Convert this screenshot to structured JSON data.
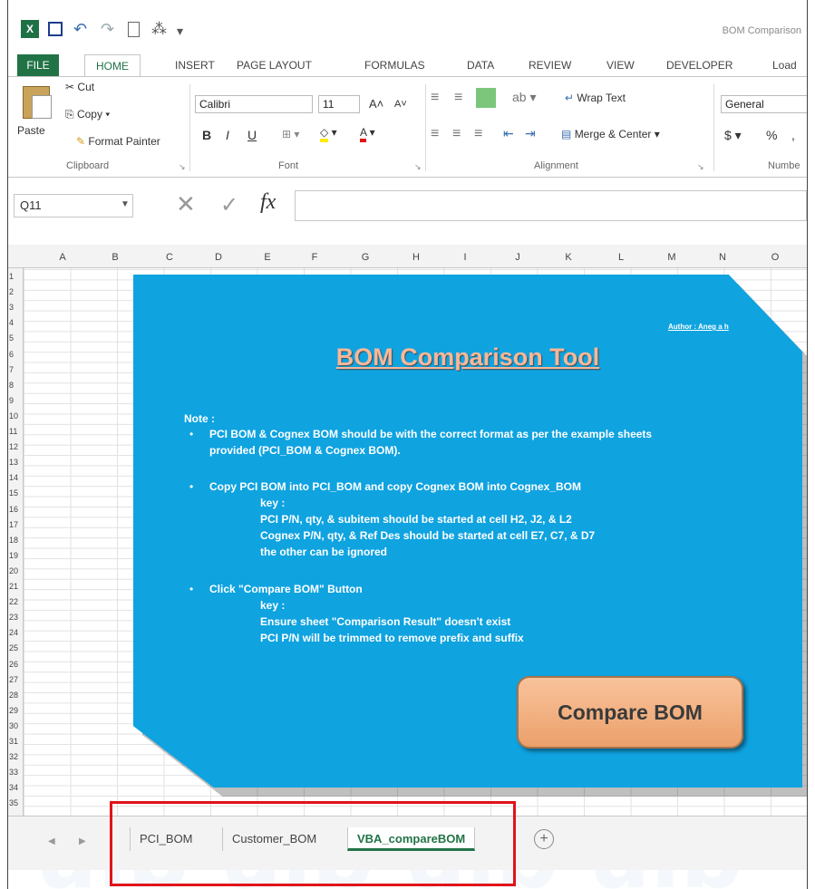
{
  "window_title": "BOM Comparison",
  "quick_access": {
    "excel_logo": "X"
  },
  "ribbon_tabs": [
    "FILE",
    "HOME",
    "INSERT",
    "PAGE LAYOUT",
    "FORMULAS",
    "DATA",
    "REVIEW",
    "VIEW",
    "DEVELOPER",
    "Load"
  ],
  "clipboard": {
    "paste": "Paste",
    "cut": "Cut",
    "copy": "Copy",
    "format_painter": "Format Painter",
    "group_label": "Clipboard"
  },
  "font": {
    "name": "Calibri",
    "size": "11",
    "bold": "B",
    "italic": "I",
    "underline": "U",
    "grow": "A˄",
    "shrink": "A˅",
    "group_label": "Font"
  },
  "alignment": {
    "wrap_text": "Wrap Text",
    "merge_center": "Merge & Center",
    "group_label": "Alignment"
  },
  "number": {
    "format": "General",
    "currency": "$",
    "percent": "%",
    "comma": ",",
    "group_label": "Numbe"
  },
  "formula_bar": {
    "name_box": "Q11",
    "fx": "fx"
  },
  "columns": [
    "A",
    "B",
    "C",
    "D",
    "E",
    "F",
    "G",
    "H",
    "I",
    "J",
    "K",
    "L",
    "M",
    "N",
    "O"
  ],
  "rows": [
    "1",
    "2",
    "3",
    "4",
    "5",
    "6",
    "7",
    "8",
    "9",
    "10",
    "11",
    "12",
    "13",
    "14",
    "15",
    "16",
    "17",
    "18",
    "19",
    "20",
    "21",
    "22",
    "23",
    "24",
    "25",
    "26",
    "27",
    "28",
    "29",
    "30",
    "31",
    "32",
    "33",
    "34",
    "35"
  ],
  "tool": {
    "author": "Author : Aneg a h",
    "title": "BOM Comparison Tool",
    "note_label": "Note :",
    "bullet1_line1": "PCI BOM & Cognex BOM should be with the correct format as per the example sheets",
    "bullet1_line2": "provided (PCI_BOM & Cognex BOM).",
    "bullet2_line1": "Copy PCI BOM into PCI_BOM and copy Cognex BOM into Cognex_BOM",
    "bullet2_key": "key :",
    "bullet2_line2": "PCI P/N, qty, & subitem should be started at cell H2, J2, & L2",
    "bullet2_line3": "Cognex P/N, qty, & Ref Des should be started at cell E7, C7, & D7",
    "bullet2_line4": "the other can be ignored",
    "bullet3_line1": "Click \"Compare BOM\" Button",
    "bullet3_key": "key :",
    "bullet3_line2": "Ensure sheet \"Comparison Result\" doesn't exist",
    "bullet3_line3": "PCI P/N will be trimmed to remove prefix and suffix",
    "button_label": "Compare BOM"
  },
  "sheets": {
    "tab1": "PCI_BOM",
    "tab2": "Customer_BOM",
    "tab3": "VBA_compareBOM",
    "add": "+"
  },
  "colors": {
    "excel_green": "#217346",
    "panel_blue": "#0fa3e0",
    "button_orange": "#eba06b",
    "highlight_red": "#e0141a"
  }
}
